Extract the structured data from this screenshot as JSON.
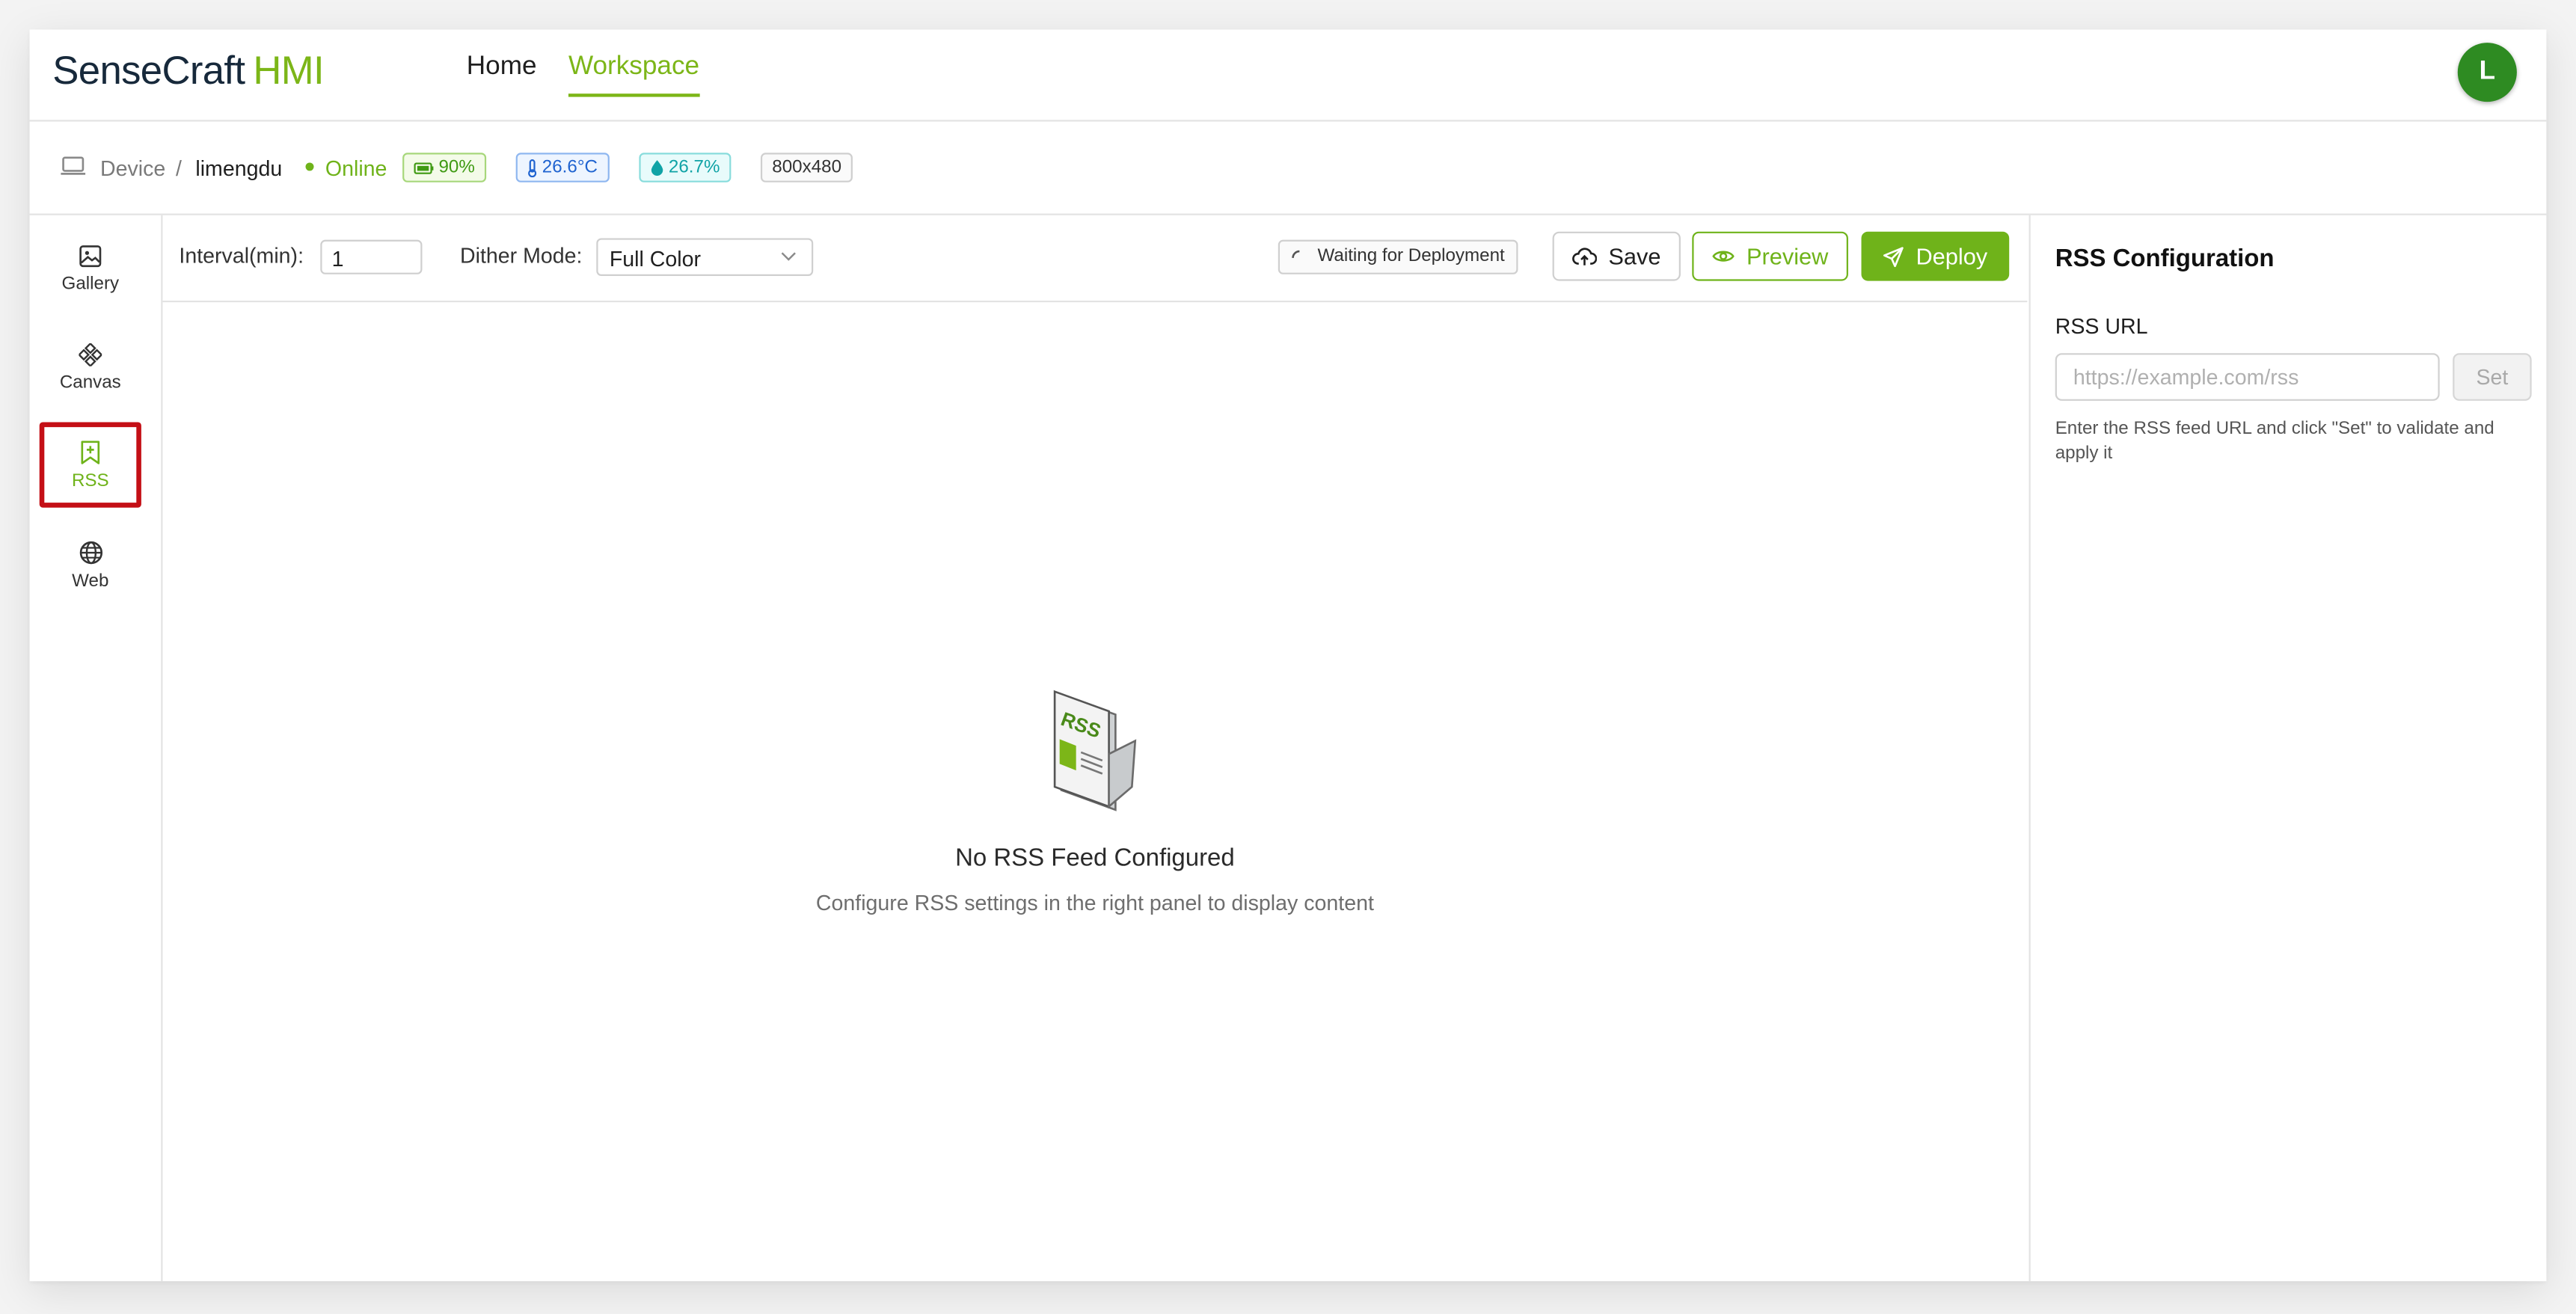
{
  "app": {
    "logo_part1": "SenseCraft",
    "logo_part2": "HMI",
    "nav": [
      {
        "label": "Home",
        "active": false
      },
      {
        "label": "Workspace",
        "active": true
      }
    ],
    "avatar_initial": "L"
  },
  "device_bar": {
    "label": "Device",
    "separator": "/",
    "name": "limengdu",
    "status": "Online",
    "battery": "90%",
    "temperature": "26.6°C",
    "humidity": "26.7%",
    "resolution": "800x480",
    "icons": [
      "laptop-icon",
      "battery-icon",
      "thermometer-icon",
      "droplet-icon"
    ]
  },
  "sidebar": {
    "items": [
      {
        "label": "Gallery",
        "icon": "image-icon",
        "active": false
      },
      {
        "label": "Canvas",
        "icon": "canvas-icon",
        "active": false
      },
      {
        "label": "RSS",
        "icon": "bookmark-plus-icon",
        "active": true
      },
      {
        "label": "Web",
        "icon": "globe-icon",
        "active": false
      }
    ]
  },
  "toolbar": {
    "interval_label": "Interval(min):",
    "interval_value": "1",
    "dither_label": "Dither Mode:",
    "dither_value": "Full Color",
    "status_text": "Waiting for Deployment",
    "save_label": "Save",
    "preview_label": "Preview",
    "deploy_label": "Deploy"
  },
  "main": {
    "empty_title": "No RSS Feed Configured",
    "empty_subtitle": "Configure RSS settings in the right panel to display content",
    "illustration_text": "RSS"
  },
  "right_panel": {
    "title": "RSS Configuration",
    "url_label": "RSS URL",
    "url_placeholder": "https://example.com/rss",
    "set_label": "Set",
    "help_text": "Enter the RSS feed URL and click \"Set\" to validate and apply it"
  },
  "colors": {
    "accent": "#6fb31a",
    "logo_dark": "#17293b",
    "avatar": "#2e8b22",
    "highlight_border": "#c40f16"
  }
}
